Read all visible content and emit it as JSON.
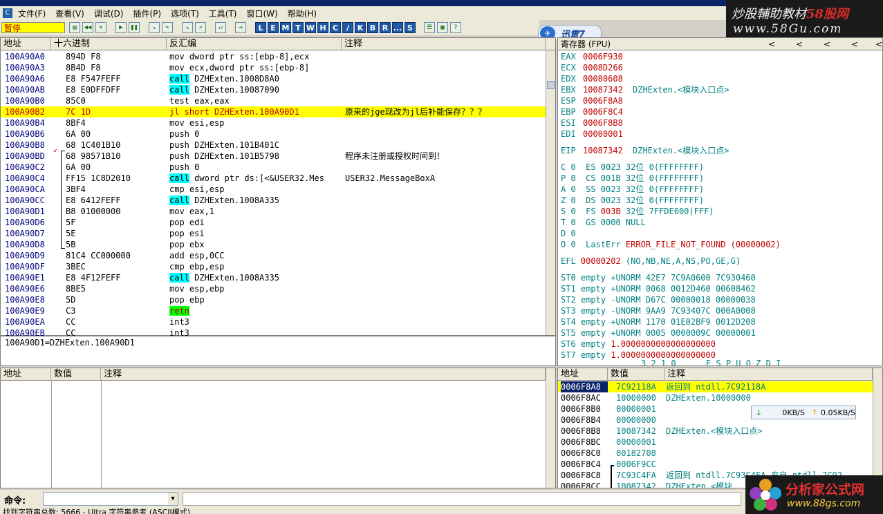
{
  "menu": [
    "文件(F)",
    "查看(V)",
    "调试(D)",
    "插件(P)",
    "选项(T)",
    "工具(T)",
    "窗口(W)",
    "帮助(H)"
  ],
  "watermark": {
    "line1_a": "炒股輔助教材",
    "line1_b": "58股网",
    "line2": "www.58Gu.com"
  },
  "status_label": "暂停",
  "toolbar_letters": [
    "L",
    "E",
    "M",
    "T",
    "W",
    "H",
    "C",
    "/",
    "K",
    "B",
    "R",
    "...",
    "S"
  ],
  "xunlei_label": "迅雷7",
  "disasm": {
    "headers": [
      "地址",
      "十六进制",
      "反汇编",
      "注释"
    ],
    "rows": [
      {
        "addr": "100A90A0",
        "hex": "894D F8",
        "asm": "mov dword ptr ss:[ebp-8],ecx",
        "comment": ""
      },
      {
        "addr": "100A90A3",
        "hex": "8B4D F8",
        "asm": "mov ecx,dword ptr ss:[ebp-8]",
        "comment": ""
      },
      {
        "addr": "100A90A6",
        "hex": "E8 F547FEFF",
        "asm_kw": "call",
        "asm_rest": " DZHExten.1008D8A0",
        "comment": ""
      },
      {
        "addr": "100A90AB",
        "hex": "E8 E0DFFDFF",
        "asm_kw": "call",
        "asm_rest": " DZHExten.10087090",
        "comment": ""
      },
      {
        "addr": "100A90B0",
        "hex": "85C0",
        "asm": "test eax,eax",
        "comment": ""
      },
      {
        "addr": "100A90B2",
        "hex": "7C 1D",
        "asm": "jl short DZHExten.100A90D1",
        "comment": "原来的jge现改为jl后补能保存？？？",
        "selected": true
      },
      {
        "addr": "100A90B4",
        "hex": "8BF4",
        "asm": "mov esi,esp",
        "comment": ""
      },
      {
        "addr": "100A90B6",
        "hex": "6A 00",
        "asm": "push 0",
        "comment": ""
      },
      {
        "addr": "100A90B8",
        "hex": "68 1C401B10",
        "asm": "push DZHExten.101B401C",
        "comment": ""
      },
      {
        "addr": "100A90BD",
        "hex": "68 98571B10",
        "asm": "push DZHExten.101B5798",
        "comment": "程序未注册或授权时间到！"
      },
      {
        "addr": "100A90C2",
        "hex": "6A 00",
        "asm": "push 0",
        "comment": ""
      },
      {
        "addr": "100A90C4",
        "hex": "FF15 1C8D2010",
        "asm_kw": "call",
        "asm_rest": " dword ptr ds:[<&USER32.Mes",
        "comment": "USER32.MessageBoxA"
      },
      {
        "addr": "100A90CA",
        "hex": "3BF4",
        "asm": "cmp esi,esp",
        "comment": ""
      },
      {
        "addr": "100A90CC",
        "hex": "E8 6412FEFF",
        "asm_kw": "call",
        "asm_rest": " DZHExten.1008A335",
        "comment": ""
      },
      {
        "addr": "100A90D1",
        "hex": "B8 01000000",
        "asm": "mov eax,1",
        "comment": ""
      },
      {
        "addr": "100A90D6",
        "hex": "5F",
        "asm": "pop edi",
        "comment": ""
      },
      {
        "addr": "100A90D7",
        "hex": "5E",
        "asm": "pop esi",
        "comment": ""
      },
      {
        "addr": "100A90D8",
        "hex": "5B",
        "asm": "pop ebx",
        "comment": ""
      },
      {
        "addr": "100A90D9",
        "hex": "81C4 CC000000",
        "asm": "add esp,0CC",
        "comment": ""
      },
      {
        "addr": "100A90DF",
        "hex": "3BEC",
        "asm": "cmp ebp,esp",
        "comment": ""
      },
      {
        "addr": "100A90E1",
        "hex": "E8 4F12FEFF",
        "asm_kw": "call",
        "asm_rest": " DZHExten.1008A335",
        "comment": ""
      },
      {
        "addr": "100A90E6",
        "hex": "8BE5",
        "asm": "mov esp,ebp",
        "comment": ""
      },
      {
        "addr": "100A90E8",
        "hex": "5D",
        "asm": "pop ebp",
        "comment": ""
      },
      {
        "addr": "100A90E9",
        "hex": "C3",
        "asm_ret": "retn",
        "comment": ""
      },
      {
        "addr": "100A90EA",
        "hex": "CC",
        "asm": "int3",
        "comment": ""
      },
      {
        "addr": "100A90EB",
        "hex": "CC",
        "asm": "int3",
        "comment": ""
      }
    ],
    "info": "100A90D1=DZHExten.100A90D1"
  },
  "registers": {
    "title": "寄存器 (FPU)",
    "arrows": [
      "<",
      "<",
      "<",
      "<",
      "<"
    ],
    "gen": [
      {
        "n": "EAX",
        "v": "0006F930",
        "c": ""
      },
      {
        "n": "ECX",
        "v": "0008D266",
        "c": ""
      },
      {
        "n": "EDX",
        "v": "00080608",
        "c": ""
      },
      {
        "n": "EBX",
        "v": "10087342",
        "c": "DZHExten.<模块入口点>"
      },
      {
        "n": "ESP",
        "v": "0006F8A8",
        "c": ""
      },
      {
        "n": "EBP",
        "v": "0006F8C4",
        "c": ""
      },
      {
        "n": "ESI",
        "v": "0006F8B8",
        "c": ""
      },
      {
        "n": "EDI",
        "v": "00000001",
        "c": ""
      }
    ],
    "eip": {
      "n": "EIP",
      "v": "10087342",
      "c": "DZHExten.<模块入口点>"
    },
    "flags": [
      "C 0  ES 0023 32位 0(FFFFFFFF)",
      "P 0  CS 001B 32位 0(FFFFFFFF)",
      "A 0  SS 0023 32位 0(FFFFFFFF)",
      "Z 0  DS 0023 32位 0(FFFFFFFF)",
      "S 0  FS 003B 32位 7FFDE000(FFF)",
      "T 0  GS 0000 NULL",
      "D 0",
      "O 0  LastErr ERROR_FILE_NOT_FOUND (00000002)"
    ],
    "efl": "EFL 00000202 (NO,NB,NE,A,NS,PO,GE,G)",
    "fpu": [
      "ST0 empty +UNORM 42E7 7C9A0600 7C930460",
      "ST1 empty +UNORM 0068 0012D460 00608462",
      "ST2 empty -UNORM D67C 00000018 00000038",
      "ST3 empty -UNORM 9AA9 7C93407C 000A0008",
      "ST4 empty +UNORM 1170 01E02BF9 0012D208",
      "ST5 empty +UNORM 0005 0000009C 00000001",
      "ST6 empty 1.0000000000000000000",
      "ST7 empty 1.0000000000000000000"
    ],
    "footer": "3 2 1 0      E S P U O Z D I"
  },
  "dump": {
    "headers": [
      "地址",
      "数值",
      "注释"
    ]
  },
  "stack": {
    "headers": [
      "地址",
      "数值",
      "注释"
    ],
    "rows": [
      {
        "addr": "0006F8A8",
        "val": "7C92118A",
        "c": "返回到 ntdll.7C92118A",
        "selected": true
      },
      {
        "addr": "0006F8AC",
        "val": "10000000",
        "c": "DZHExten.10000000"
      },
      {
        "addr": "0006F8B0",
        "val": "00000001",
        "c": ""
      },
      {
        "addr": "0006F8B4",
        "val": "00000000",
        "c": ""
      },
      {
        "addr": "0006F8B8",
        "val": "10087342",
        "c": "DZHExten.<模块入口点>"
      },
      {
        "addr": "0006F8BC",
        "val": "00000001",
        "c": ""
      },
      {
        "addr": "0006F8C0",
        "val": "00182708",
        "c": ""
      },
      {
        "addr": "0006F8C4",
        "val": "0006F9CC",
        "c": ""
      },
      {
        "addr": "0006F8C8",
        "val": "7C93C4FA",
        "c": "返回到 ntdll.7C93C4FA 来自 ntdll.7C92"
      },
      {
        "addr": "0006F8CC",
        "val": "10087342",
        "c": "DZHExten.<模块"
      }
    ]
  },
  "speed": {
    "down": "0KB/S",
    "up": "0.05KB/S"
  },
  "command": {
    "label": "命令:"
  },
  "bottom_status": "找到字符串总数: 5666 - Ultra 字符串参考 (ASCII模式)",
  "logo2": {
    "name": "分析家公式网",
    "url": "www.88gs.com"
  },
  "colors": {
    "selected": "#ffff00",
    "call": "#00ffff",
    "retn": "#00ff00",
    "red": "#c00000",
    "teal": "#008080"
  }
}
